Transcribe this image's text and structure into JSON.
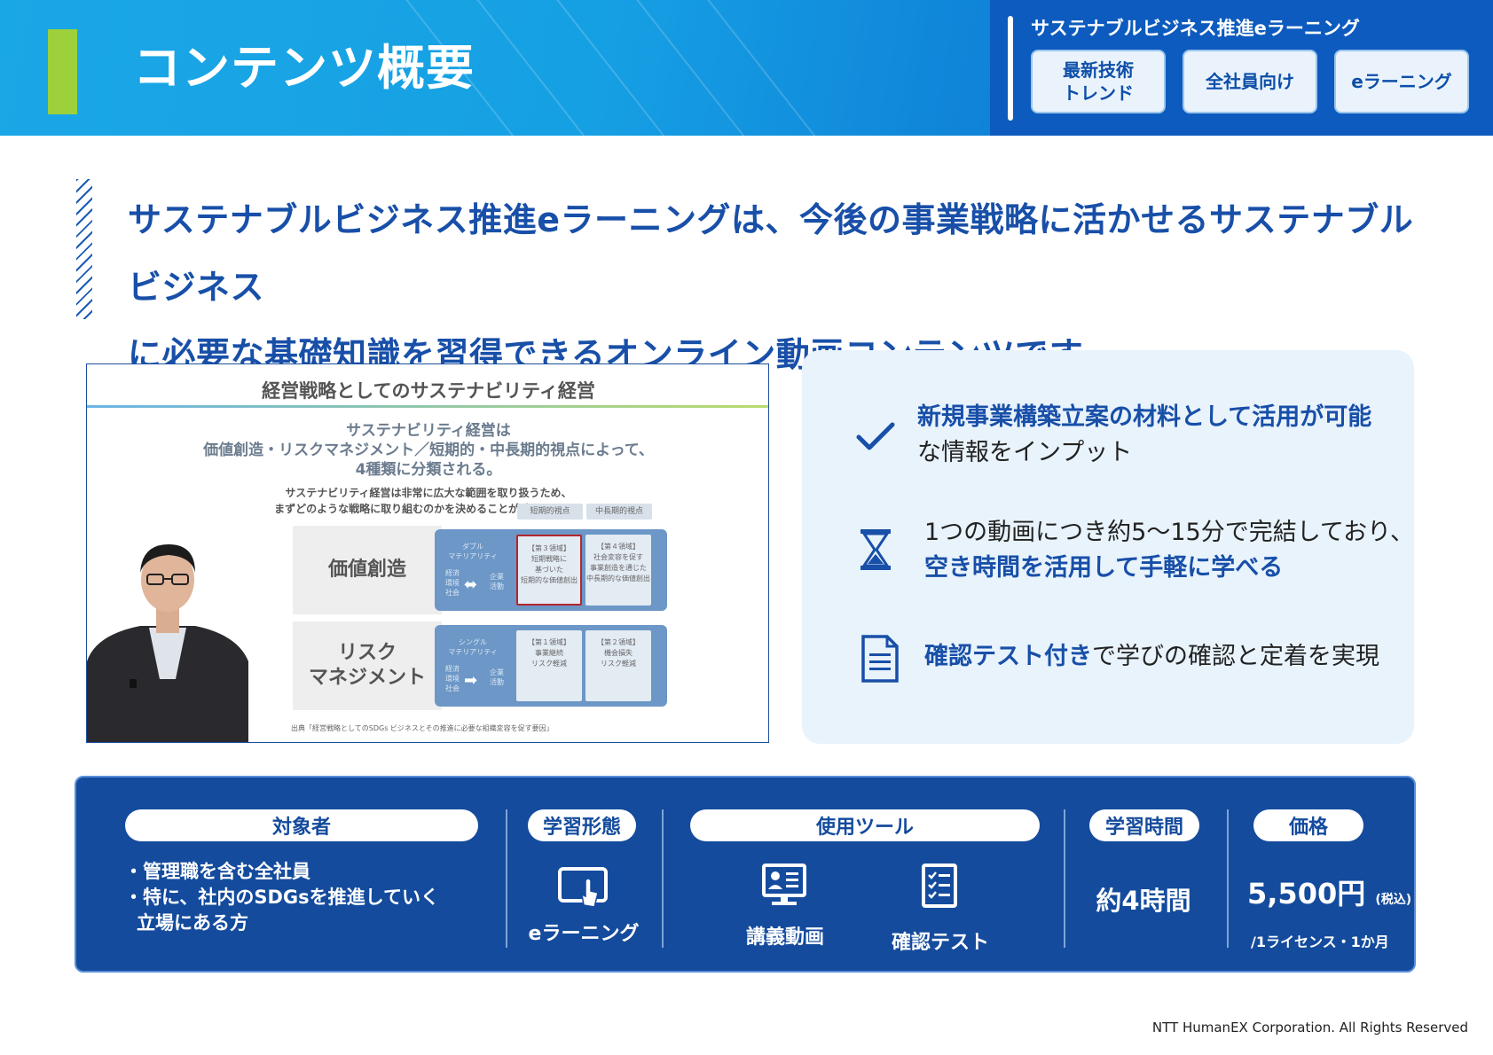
{
  "header": {
    "title": "コンテンツ概要",
    "course_name": "サステナブルビジネス推進eラーニング",
    "tags": [
      "最新技術\nトレンド",
      "全社員向け",
      "eラーニング"
    ]
  },
  "lead": {
    "line1": "サステナブルビジネス推進eラーニングは、今後の事業戦略に活かせるサステナブルビジネス",
    "line2": "に必要な基礎知識を習得できるオンライン動画コンテンツです。"
  },
  "video": {
    "slide_title": "経営戦略としてのサステナビリティ経営",
    "line1": "サステナビリティ経営は",
    "line2": "価値創造・リスクマネジメント／短期的・中長期的視点によって、",
    "line3": "4種類に分類される。",
    "line4": "サステナビリティ経営は非常に広大な範囲を取り扱うため、",
    "line5": "まずどのような戦略に取り組むのかを決めることが重要となる。",
    "col1": "短期的視点",
    "col2": "中長期的視点",
    "row1": "価値創造",
    "row2": "リスク\nマネジメント",
    "band1_left": "ダブル\nマテリアリティ",
    "band2_left": "シングル\nマテリアリティ",
    "band_small": "経済\n環境\n社会",
    "band_right": "企業\n活動",
    "cell3": "【第３領域】\n短期戦略に\n基づいた\n短期的な価値創出",
    "cell4": "【第４領域】\n社会変容を促す\n事業創造を通じた\n中長期的な価値創出",
    "cell1": "【第１領域】\n事業継続\nリスク軽減",
    "cell2": "【第２領域】\n機会損失\nリスク軽減",
    "source": "出典「経営戦略としてのSDGs ビジネスとその推進に必要な組織変容を促す要因」"
  },
  "features": {
    "f1_bold": "新規事業構築立案の材料として活用が可能",
    "f1_rest": "な情報をインプット",
    "f2_rest": "1つの動画につき約5～15分で完結しており、",
    "f2_bold": "空き時間を活用して手軽に学べる",
    "f3_bold": "確認テスト付き",
    "f3_rest": "で学びの確認と定着を実現"
  },
  "info": {
    "target_label": "対象者",
    "target_l1": "・管理職を含む全社員",
    "target_l2": "・特に、社内のSDGsを推進していく",
    "target_l3": "立場にある方",
    "format_label": "学習形態",
    "format_value": "eラーニング",
    "tools_label": "使用ツール",
    "tool1": "講義動画",
    "tool2": "確認テスト",
    "time_label": "学習時間",
    "time_value": "約4時間",
    "price_label": "価格",
    "price_value": "5,500円",
    "price_tax": "(税込)",
    "price_unit": "/1ライセンス・1か月"
  },
  "footer": "NTT HumanEX Corporation. All Rights Reserved"
}
